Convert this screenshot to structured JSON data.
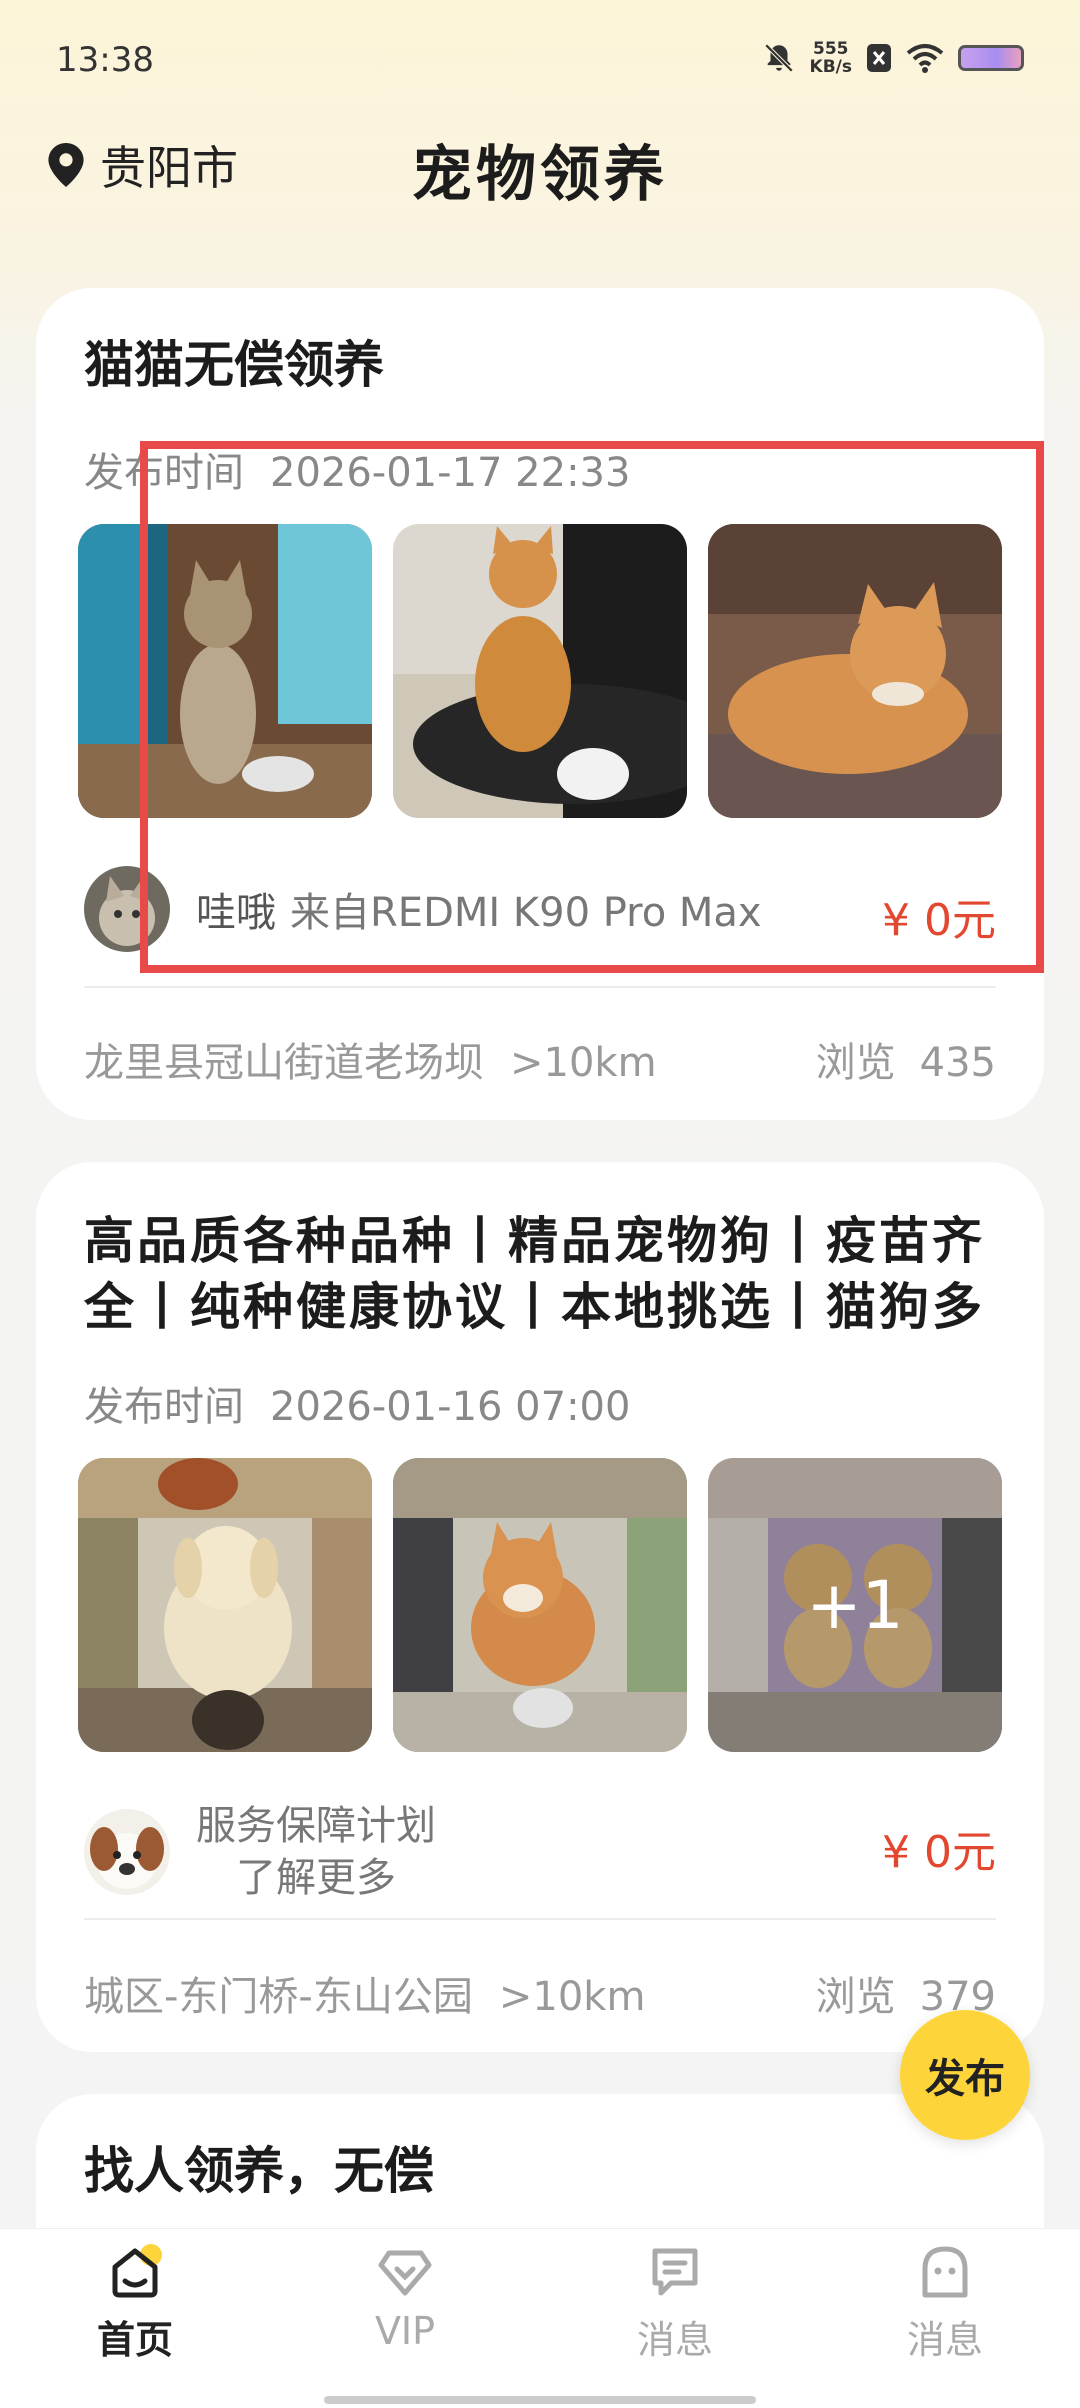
{
  "status_bar": {
    "time": "13:38",
    "net_speed_value": "555",
    "net_speed_unit": "KB/s"
  },
  "header": {
    "location": "贵阳市",
    "title": "宠物领养"
  },
  "posts": [
    {
      "title": "猫猫无偿领养",
      "posted_label": "发布时间",
      "posted_time": "2026-01-17 22:33",
      "user_name": "哇哦",
      "user_device": "来自REDMI K90 Pro Max",
      "price": "¥ 0元",
      "address": "龙里县冠山街道老场坝",
      "distance": ">10km",
      "views_label": "浏览",
      "views": "435"
    },
    {
      "title": "高品质各种品种丨精品宠物狗丨疫苗齐全丨纯种健康协议丨本地挑选丨猫狗多",
      "posted_label": "发布时间",
      "posted_time": "2026-01-16 07:00",
      "service_line1": "服务保障计划",
      "service_line2": "了解更多",
      "price": "¥ 0元",
      "extra_photos": "+1",
      "address": "城区-东门桥-东山公园",
      "distance": ">10km",
      "views_label": "浏览",
      "views": "379"
    },
    {
      "title": "找人领养，无偿"
    }
  ],
  "fab_label": "发布",
  "tabs": [
    {
      "label": "首页",
      "icon": "home-icon",
      "active": true
    },
    {
      "label": "VIP",
      "icon": "vip-heart-icon",
      "active": false
    },
    {
      "label": "消息",
      "icon": "message-icon",
      "active": false
    },
    {
      "label": "消息",
      "icon": "profile-icon",
      "active": false
    }
  ],
  "colors": {
    "accent": "#fdd53a",
    "price": "#e2472f",
    "highlight": "#e84a4a"
  }
}
